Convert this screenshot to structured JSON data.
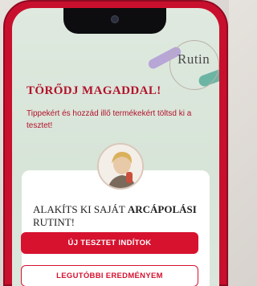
{
  "brand": {
    "name": "Rutin"
  },
  "hero": {
    "title": "TÖRŐDJ MAGADDAL!",
    "subtitle": "Tippekért és hozzád illő termékekért töltsd ki a tesztet!"
  },
  "card": {
    "title_part1": "ALAKÍTS KI SAJÁT ",
    "title_bold": "ARCÁPOLÁSI",
    "title_part2": " RUTINT!",
    "primary_button": "ÚJ TESZTET INDÍTOK",
    "secondary_button": "LEGUTÓBBI EREDMÉNYEM"
  },
  "icons": {
    "avatar": "woman-portrait",
    "camera": "front-camera"
  },
  "colors": {
    "accent": "#d6122f",
    "phone_frame": "#c8102e",
    "screen_bg": "#dce7dc"
  }
}
